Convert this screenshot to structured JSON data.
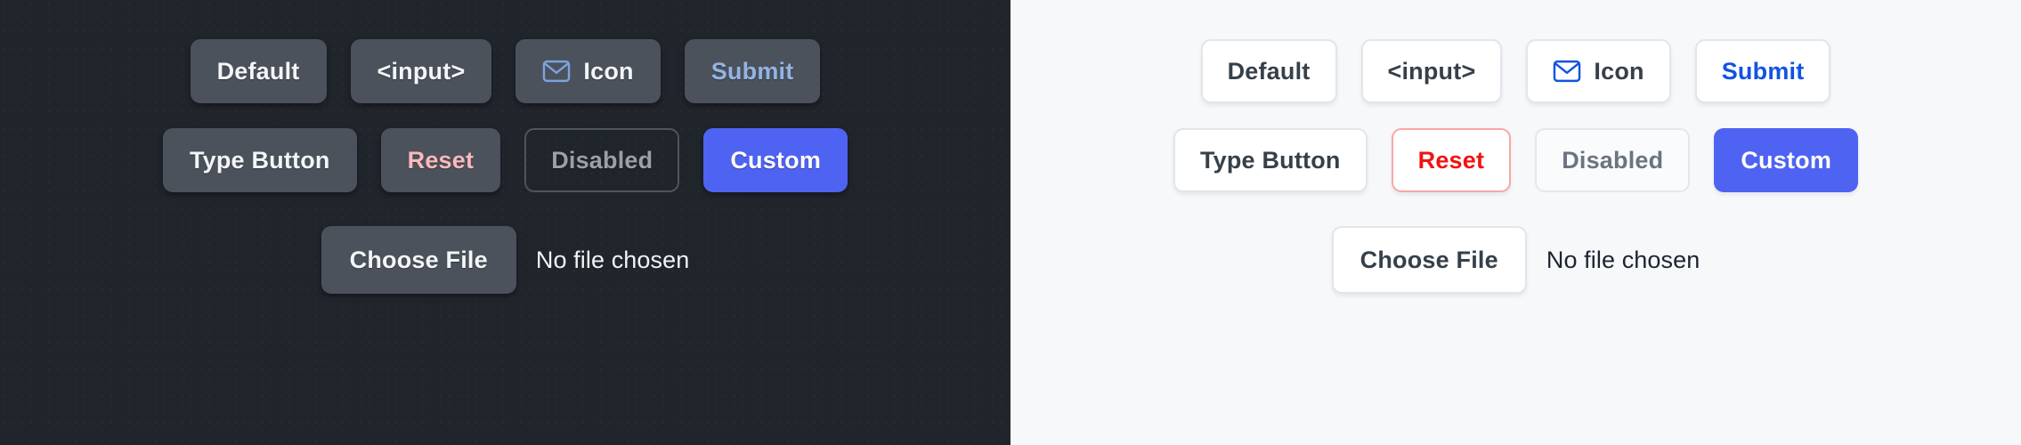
{
  "panels": [
    {
      "theme": "dark",
      "background": "#20242b",
      "rows": [
        [
          {
            "label": "Default",
            "name": "default-button",
            "variant": "default",
            "icon": null
          },
          {
            "label": "<input>",
            "name": "input-button",
            "variant": "default",
            "icon": null
          },
          {
            "label": "Icon",
            "name": "icon-button",
            "variant": "default",
            "icon": "envelope-icon"
          },
          {
            "label": "Submit",
            "name": "submit-button",
            "variant": "submit",
            "icon": null
          }
        ],
        [
          {
            "label": "Type Button",
            "name": "type-button",
            "variant": "default",
            "icon": null
          },
          {
            "label": "Reset",
            "name": "reset-button",
            "variant": "reset",
            "icon": null
          },
          {
            "label": "Disabled",
            "name": "disabled-button",
            "variant": "disabled",
            "icon": null
          },
          {
            "label": "Custom",
            "name": "custom-button",
            "variant": "custom",
            "icon": null
          }
        ]
      ],
      "file_input": {
        "button_label": "Choose File",
        "status_text": "No file chosen"
      }
    },
    {
      "theme": "light",
      "background": "#f6f8fa",
      "rows": [
        [
          {
            "label": "Default",
            "name": "default-button",
            "variant": "default",
            "icon": null
          },
          {
            "label": "<input>",
            "name": "input-button",
            "variant": "default",
            "icon": null
          },
          {
            "label": "Icon",
            "name": "icon-button",
            "variant": "default",
            "icon": "envelope-icon"
          },
          {
            "label": "Submit",
            "name": "submit-button",
            "variant": "submit",
            "icon": null
          }
        ],
        [
          {
            "label": "Type Button",
            "name": "type-button",
            "variant": "default",
            "icon": null
          },
          {
            "label": "Reset",
            "name": "reset-button",
            "variant": "reset",
            "icon": null
          },
          {
            "label": "Disabled",
            "name": "disabled-button",
            "variant": "disabled",
            "icon": null
          },
          {
            "label": "Custom",
            "name": "custom-button",
            "variant": "custom",
            "icon": null
          }
        ]
      ],
      "file_input": {
        "button_label": "Choose File",
        "status_text": "No file chosen"
      }
    }
  ],
  "colors": {
    "dark_panel_bg": "#20242b",
    "dark_button_bg": "#4b525c",
    "dark_button_text": "#f3f5f7",
    "dark_submit_text": "#93b4e3",
    "dark_reset_text": "#fbb9bb",
    "dark_disabled_text": "#9aa0a8",
    "dark_disabled_border": "#4e555f",
    "light_panel_bg": "#f6f8fa",
    "light_button_bg": "#ffffff",
    "light_button_border": "#e2e6ea",
    "light_button_text": "#36404a",
    "light_submit_text": "#1154e0",
    "light_reset_text": "#f01313",
    "light_reset_border": "#f8a7a7",
    "light_disabled_text": "#6b7480",
    "custom_accent": "#4f63f2",
    "custom_text": "#ffffff",
    "envelope_dark": "#7ba3dd",
    "envelope_light": "#1154e0"
  }
}
